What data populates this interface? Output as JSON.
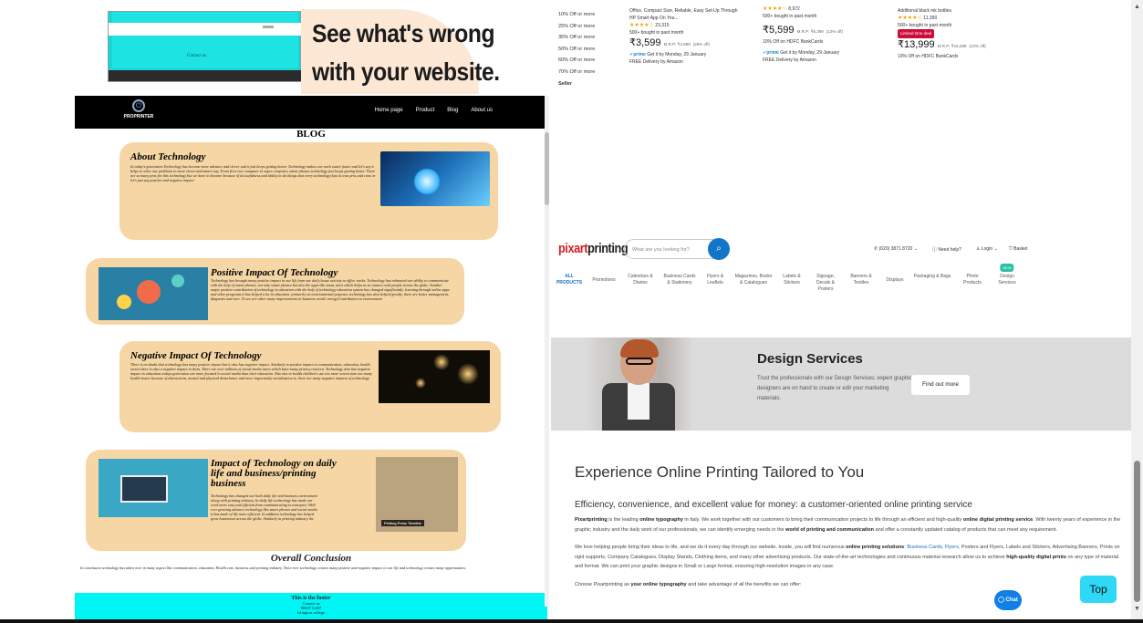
{
  "left": {
    "promo": {
      "headline_line1": "See what's wrong",
      "headline_line2": "with your website.",
      "screenshot_contact": "Contact us"
    },
    "nav": {
      "logo_text": "PROPRINTER",
      "links": [
        "Home page",
        "Product",
        "Blog",
        "About us"
      ]
    },
    "blog_title": "BLOG",
    "cards": [
      {
        "title": "About Technology",
        "body": "In today's generation Technology has become more advance and clever and it just keeps getting better. Technology makes our work easier faster and let's say it helps to solve our problems in more clever and smart way. From first ever computer to super computer, smart phones technology just keeps getting better. There are so many pros for this technology but we have to become because of its usefulness and ability to do things that every technology has its own pros and cons or let's just say positive and negative impact."
      },
      {
        "title": "Positive Impact Of Technology",
        "body": "Technology has brought many positive impact in our life from our daily house activity to office works. Technology has enhanced our ability to communicate with the help of smart phones, not only smart phones but also the apps like zoom, meet which helps us to connect with people across the globe. Another major positive contribution of technology is education with the help of technology education system has changed significantly. learning through online apps and other programs it has helped a lot in education. primarily on environmental purposes technology has also helped greatly. there are better management, diagnosis and cure. To see are other many improvements in business world. energy/Contribution to environment"
      },
      {
        "title": "Negative Impact Of Technology",
        "body": "There is no doubt that technology has many positive impact but it also has negative impact. Similarly to positive impact in communication, education, health sector there is also a negative impact in them. There are over millions of social media users which have many privacy concern. Technology also has negative impact in education todays generation are more focused in social media than their education. Also due to health children's use too more screen time too many health issues because of distractions, mental and physical disturbance and more importantly socialization is, there are many negative impacts of technology."
      },
      {
        "title": "Impact of Technology on daily life and business/printing business",
        "body": "Technology has changed our both daily life and business environment along with printing industry. In daily life technology has made our work more easy and efficient from communicating to transport. With ever growing advance technology like smart phones and social media it has made of life more efficient. In addition technology has helped grow businesses across the globe. Similarly in printing industry the old, slow and primitive method of printing has been replaced with more faster, efficient and advance printing technology. The modern printers are more faster, and easier to use although it is expensive but the output is more. however modern printing has made negative impact in our life and business, which includes paper waste, increase in energy consumption.",
        "image_caption": "Printing Press Timeline"
      }
    ],
    "conclusion": {
      "title": "Overall Conclusion",
      "body": "In conclusion technology has taken over in many aspect like communication, education, Health care, business and printing industry. Slow-ever technology creates many positive and negative impact in our life and technology creates many opportunities."
    },
    "footer": {
      "title": "This is the footer",
      "line1": "Contact us",
      "line2": "9840712287",
      "line3": "Islington college"
    }
  },
  "right": {
    "amazon": {
      "filters": [
        "10% Off or more",
        "25% Off or more",
        "35% Off or more",
        "50% Off or more",
        "60% Off or more",
        "70% Off or more"
      ],
      "seller_label": "Seller",
      "products": [
        {
          "title": "Office, Compact Size, Reliable, Easy Set-Up Through HP Smart App On You...",
          "stars": "★★★★☆",
          "rating_count": "23,315",
          "bought": "500+ bought in past month",
          "price": "₹3,599",
          "mrp": "M.R.P: ₹4,999",
          "off": "(28% off)",
          "prime": "✓prime",
          "delivery": "Get it by Monday, 29 January",
          "free": "FREE Delivery by Amazon"
        },
        {
          "title": "",
          "stars": "★★★★☆",
          "rating_count": "8,972",
          "bought": "500+ bought in past month",
          "price": "₹5,599",
          "mrp": "M.R.P: ₹6,399",
          "off": "(12% off)",
          "bank": "10% Off on HDFC BankCards",
          "prime": "✓prime",
          "delivery": "Get it by Monday, 29 January",
          "free": "FREE Delivery by Amazon"
        },
        {
          "title": "Additional black ink bottles.",
          "stars": "★★★★☆",
          "rating_count": "11,390",
          "bought": "500+ bought in past month",
          "deal": "Limited time deal",
          "price": "₹13,999",
          "mrp": "M.R.P: ₹18,299",
          "off": "(23% off)",
          "bank": "10% Off on HDFC BankCards"
        }
      ]
    },
    "pixart": {
      "logo_a": "pixart",
      "logo_b": "printing",
      "search_placeholder": "What are you looking for?",
      "phone": "(020) 3871 8720",
      "need_help": "Need help?",
      "login": "Login",
      "basket": "Basket",
      "new_badge": "NEW",
      "categories": [
        "ALL PRODUCTS",
        "Promotions",
        "Calendars & Diaries",
        "Business Cards & Stationery",
        "Flyers & Leaflets",
        "Magazines, Books & Catalogues",
        "Labels & Stickers",
        "Signage, Decals & Posters",
        "Banners & Textiles",
        "Displays",
        "Packaging & Bags",
        "Photo Products",
        "Design Services"
      ]
    },
    "banner": {
      "title": "Design Services",
      "body": "Trust the professionals with our Design Services: expert graphic designers are on hand to create or edit your marketing materials.",
      "button": "Find out more"
    },
    "experience": {
      "heading": "Experience Online Printing Tailored to You",
      "subheading": "Efficiency, convenience, and excellent value for money: a customer-oriented online printing service",
      "p1_a": "Pixartprinting",
      "p1_b": " is the leading ",
      "p1_c": "online typography",
      "p1_d": " in Italy. We work together with our customers to bring their communication projects to life through an efficient and high-quality ",
      "p1_e": "online digital printing service",
      "p1_f": ". With twenty years of experience in the graphic industry and the daily work of our professionals, we can identify emerging needs in the ",
      "p1_g": "world of printing and communication",
      "p1_h": " and offer a constantly updated catalog of products that can meet any requirement.",
      "p2_a": "We love helping people bring their ideas to life, and we do it every day through our website. Inside, you will find numerous ",
      "p2_b": "online printing solutions",
      "p2_c": ": ",
      "p2_links": "Business Cards, Flyers,",
      "p2_d": " Posters and Flyers, Labels and Stickers, Advertising Banners, Prints on rigid supports, Company Catalogues, Display Stands, Clothing items, and many other advertising products. Our state-of-the-art technologies and continuous material research allow us to achieve ",
      "p2_e": "high-quality digital prints",
      "p2_f": " on any type of material and format. We can print your graphic designs in Small or Large format, ensuring high-resolution images in any case.",
      "p3_a": "Choose Pixartprinting as ",
      "p3_b": "your online typography",
      "p3_c": " and take advantage of all the benefits we can offer:"
    },
    "chat": "Chat"
  },
  "top_button": "Top"
}
